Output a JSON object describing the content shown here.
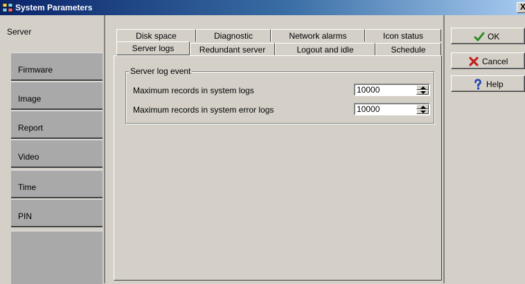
{
  "window": {
    "title": "System Parameters",
    "close_glyph": "X"
  },
  "sidebar": {
    "items": [
      {
        "label": "Server",
        "active": true
      },
      {
        "label": "Firmware"
      },
      {
        "label": "Image"
      },
      {
        "label": "Report"
      },
      {
        "label": "Video"
      },
      {
        "label": "Time"
      },
      {
        "label": "PIN"
      }
    ]
  },
  "tabs": {
    "row_back": [
      "Disk space",
      "Diagnostic",
      "Network alarms",
      "Icon status"
    ],
    "row_front": [
      "Server logs",
      "Redundant server",
      "Logout and idle",
      "Schedule"
    ],
    "active": "Server logs"
  },
  "server_logs": {
    "group_title": "Server log event",
    "fields": [
      {
        "label": "Maximum records in system logs",
        "value": "10000"
      },
      {
        "label": "Maximum records in system error logs",
        "value": "10000"
      }
    ]
  },
  "buttons": {
    "ok": {
      "label": "OK",
      "icon": "checkmark-icon",
      "color": "#2e8b22"
    },
    "cancel": {
      "label": "Cancel",
      "icon": "red-x-icon",
      "color": "#c02020"
    },
    "help": {
      "label": "Help",
      "icon": "question-icon",
      "color": "#1a3fb0"
    }
  }
}
